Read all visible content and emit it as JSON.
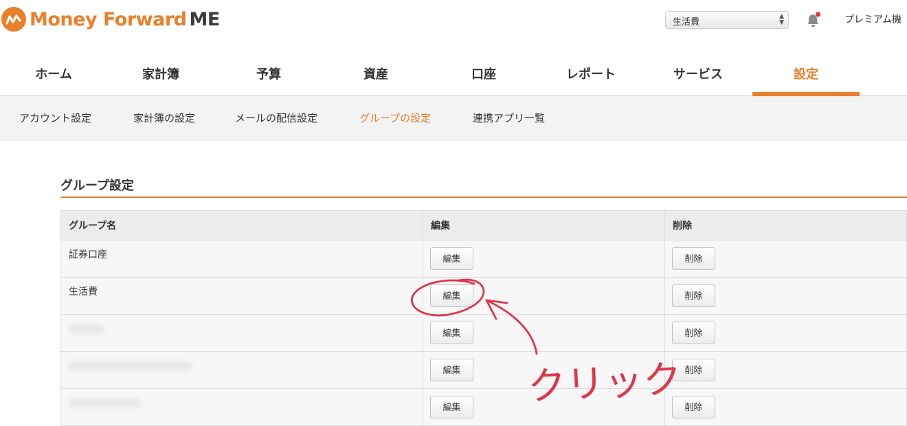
{
  "header": {
    "logo_brand": "Money Forward",
    "logo_suffix": "ME",
    "group_select_value": "生活費",
    "premium_label": "プレミアム機"
  },
  "global_nav": [
    {
      "label": "ホーム",
      "active": false
    },
    {
      "label": "家計簿",
      "active": false
    },
    {
      "label": "予算",
      "active": false
    },
    {
      "label": "資産",
      "active": false
    },
    {
      "label": "口座",
      "active": false
    },
    {
      "label": "レポート",
      "active": false
    },
    {
      "label": "サービス",
      "active": false
    },
    {
      "label": "設定",
      "active": true
    }
  ],
  "sub_nav": [
    {
      "label": "アカウント設定",
      "active": false
    },
    {
      "label": "家計簿の設定",
      "active": false
    },
    {
      "label": "メールの配信設定",
      "active": false
    },
    {
      "label": "グループの設定",
      "active": true
    },
    {
      "label": "連携アプリ一覧",
      "active": false
    }
  ],
  "section": {
    "title": "グループ設定"
  },
  "table": {
    "headers": [
      "グループ名",
      "編集",
      "削除"
    ],
    "edit_label": "編集",
    "delete_label": "削除",
    "rows": [
      {
        "name": "証券口座"
      },
      {
        "name": "生活費"
      },
      {
        "name": ""
      },
      {
        "name": ""
      },
      {
        "name": ""
      }
    ]
  },
  "annotation": {
    "text": "クリック"
  },
  "colors": {
    "accent": "#e9802b",
    "annotation": "#e0344a"
  }
}
